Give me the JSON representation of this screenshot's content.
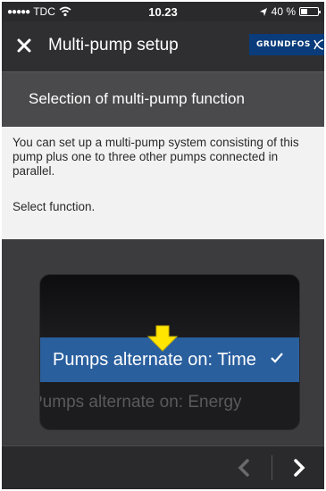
{
  "status_bar": {
    "signal": "●●●●●",
    "carrier": "TDC",
    "time": "10.23",
    "battery_percent": "40 %",
    "battery_level": 0.4
  },
  "header": {
    "title": "Multi-pump setup",
    "close_icon": "close-icon",
    "logo_text": "GRUNDFOS"
  },
  "section": {
    "title": "Selection of multi-pump function"
  },
  "info": {
    "description": "You can set up a multi-pump system consisting of this pump plus one to three other pumps connected in parallel.",
    "instruction": "Select function."
  },
  "picker": {
    "selected": "Pumps alternate on: Time",
    "next": "Pumps alternate on: Energy"
  },
  "footer": {
    "prev_icon": "chevron-left-icon",
    "next_icon": "chevron-right-icon"
  },
  "colors": {
    "selection": "#2a5f9e",
    "brand": "#0a3b7a",
    "pointer": "#ffe500"
  }
}
